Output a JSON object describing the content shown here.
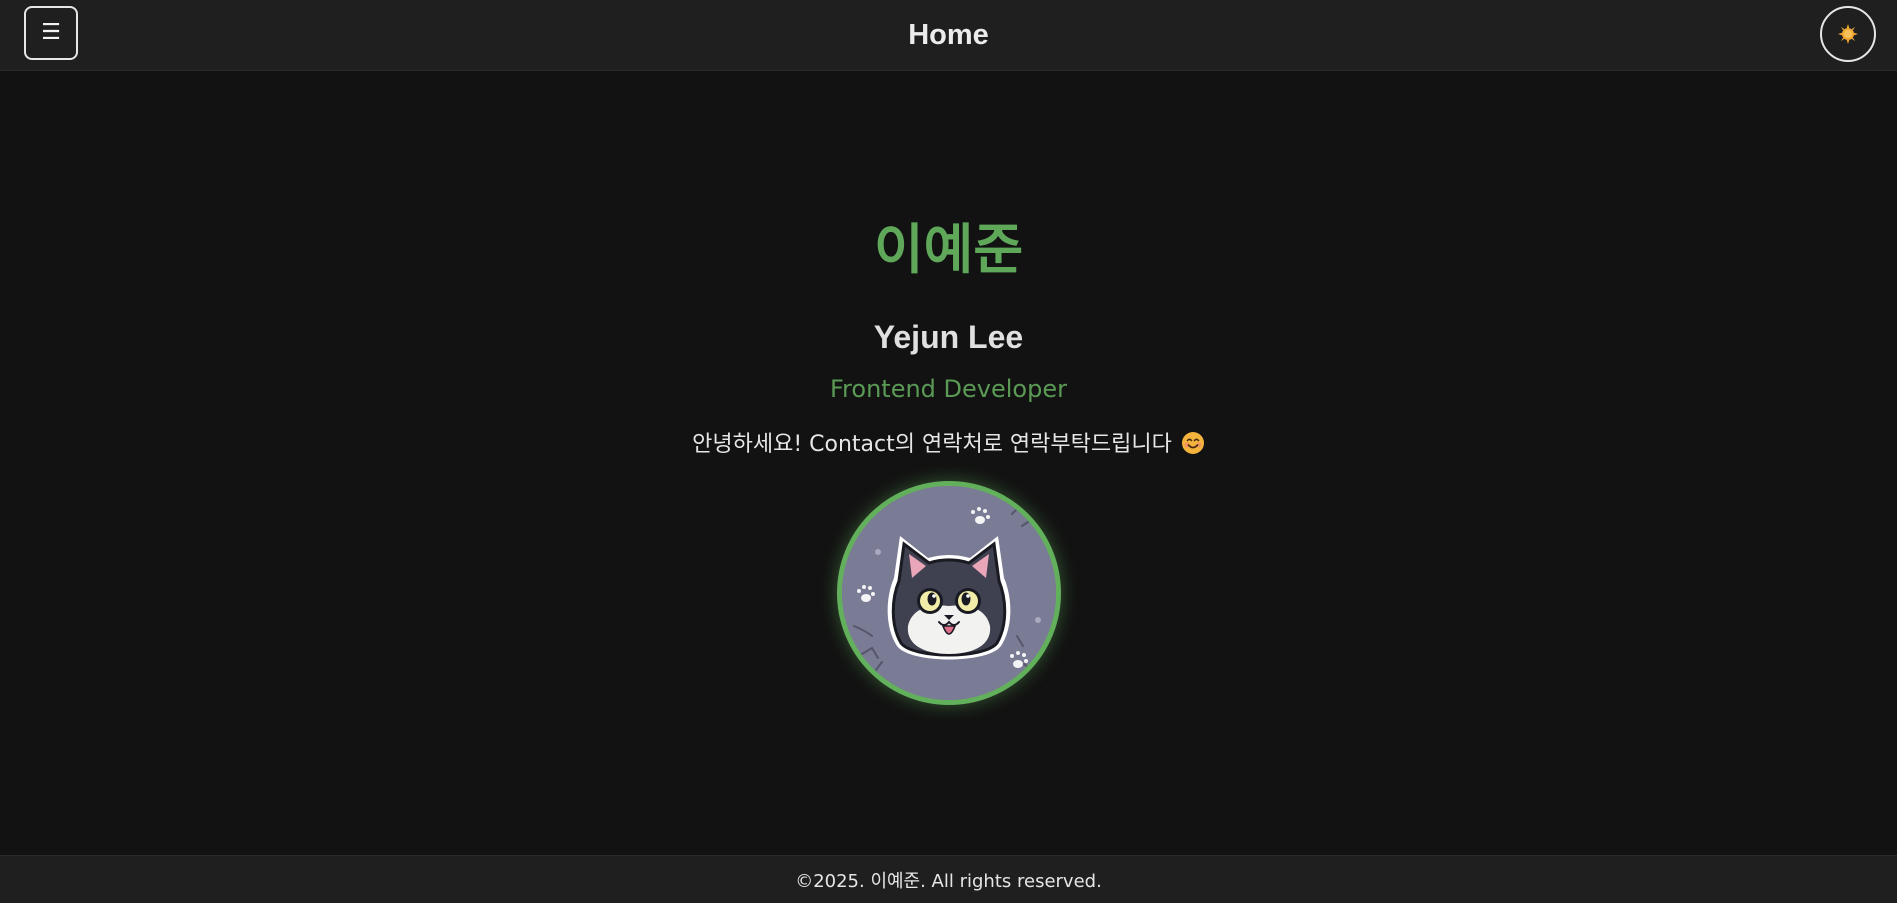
{
  "header": {
    "title": "Home",
    "menu_icon": "☰",
    "menu_icon_name": "hamburger-menu-icon",
    "theme_icon_name": "sun-icon"
  },
  "profile": {
    "name_korean": "이예준",
    "name_english": "Yejun Lee",
    "role": "Frontend Developer",
    "greeting": "안녕하세요! Contact의 연락처로 연락부탁드립니다",
    "greeting_emoji": "smiling-face-emoji",
    "avatar": "cat-avatar"
  },
  "footer": {
    "copyright": "©2025. 이예준. All rights reserved."
  },
  "colors": {
    "accent": "#5fa85a",
    "background": "#121212",
    "header_bg": "#1f1f1f",
    "sun": "#f0a830"
  }
}
